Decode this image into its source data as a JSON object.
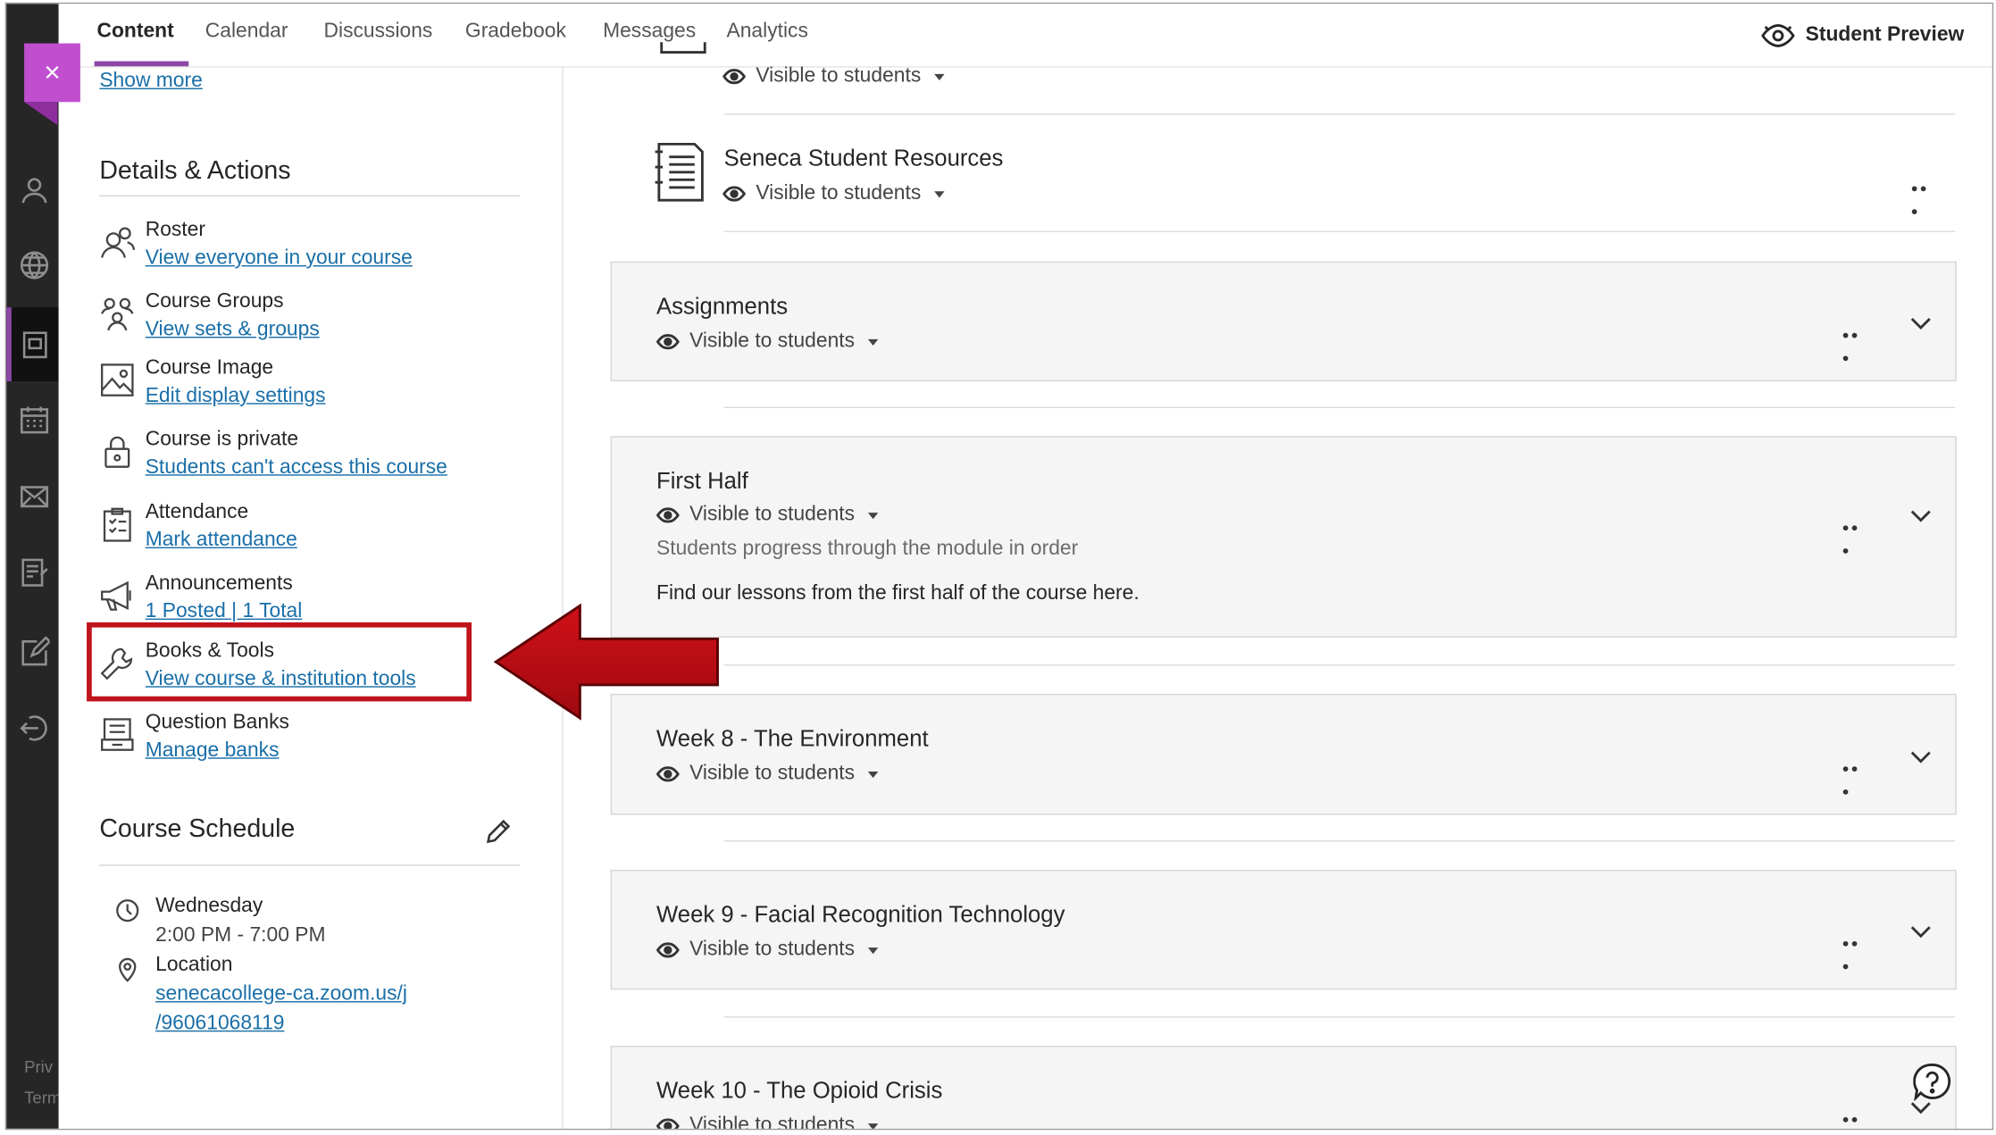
{
  "nav": {
    "tabs": [
      {
        "label": "Content"
      },
      {
        "label": "Calendar"
      },
      {
        "label": "Discussions"
      },
      {
        "label": "Gradebook"
      },
      {
        "label": "Messages"
      },
      {
        "label": "Analytics"
      }
    ],
    "active_tab": "Content",
    "student_preview_label": "Student Preview"
  },
  "rail": {
    "icons": [
      "person-icon",
      "globe-icon",
      "courses-icon",
      "calendar-icon",
      "mail-icon",
      "grades-icon",
      "edit-icon",
      "signout-icon"
    ],
    "footer_privacy": "Priv",
    "footer_terms": "Term"
  },
  "close_button_label": "×",
  "left_panel": {
    "show_more": "Show more",
    "details_title": "Details & Actions",
    "items": [
      {
        "icon": "roster-icon",
        "title": "Roster",
        "link": "View everyone in your course"
      },
      {
        "icon": "groups-icon",
        "title": "Course Groups",
        "link": "View sets & groups"
      },
      {
        "icon": "image-icon",
        "title": "Course Image",
        "link": "Edit display settings"
      },
      {
        "icon": "lock-icon",
        "title": "Course is private",
        "link": "Students can't access this course"
      },
      {
        "icon": "attendance-icon",
        "title": "Attendance",
        "link": "Mark attendance"
      },
      {
        "icon": "megaphone-icon",
        "title": "Announcements",
        "link": "1 Posted | 1 Total"
      },
      {
        "icon": "wrench-icon",
        "title": "Books & Tools",
        "link": "View course & institution tools"
      },
      {
        "icon": "bank-icon",
        "title": "Question Banks",
        "link": "Manage banks"
      }
    ],
    "schedule_title": "Course Schedule",
    "schedule": {
      "day": "Wednesday",
      "time": "2:00 PM - 7:00 PM",
      "location_label": "Location",
      "location_link_1": "senecacollege-ca.zoom.us/j",
      "location_link_2": "/96061068119"
    }
  },
  "content": {
    "visibility_label": "Visible to students",
    "documents": [
      {
        "title": "Seneca Student Resources"
      }
    ],
    "modules": [
      {
        "title": "Assignments",
        "sub": "",
        "desc": ""
      },
      {
        "title": "First Half",
        "sub": "Students progress through the module in order",
        "desc": "Find our lessons from the first half of the course here."
      },
      {
        "title": "Week 8 - The Environment",
        "sub": "",
        "desc": ""
      },
      {
        "title": "Week 9 - Facial Recognition Technology",
        "sub": "",
        "desc": ""
      },
      {
        "title": "Week 10 - The Opioid Crisis",
        "sub": "",
        "desc": ""
      }
    ]
  },
  "colors": {
    "accent": "#8c47a6",
    "close_tab": "#c04fd0",
    "link": "#1a6fa8",
    "highlight": "#c0141c",
    "rail": "#262626"
  }
}
